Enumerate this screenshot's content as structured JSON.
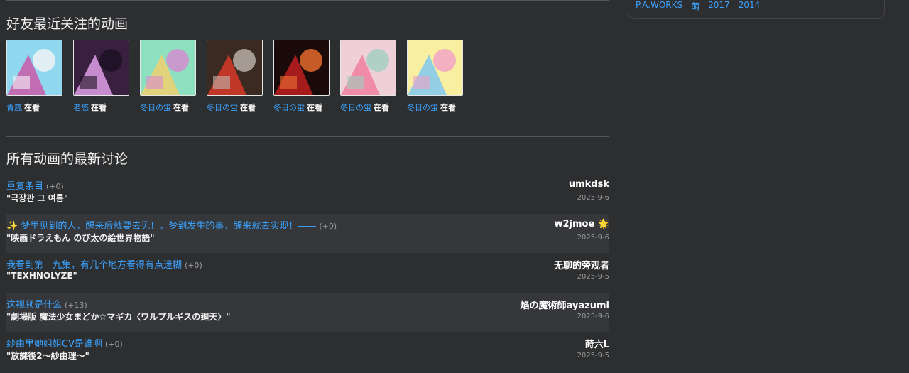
{
  "sidebar": {
    "tags": [
      "P.A.WORKS",
      "萌",
      "2017",
      "2014"
    ]
  },
  "friends_section": {
    "title": "好友最近关注的动画",
    "items": [
      {
        "user": "青嵐",
        "status": "在看",
        "colors": [
          "#8fd8f0",
          "#c95aa8",
          "#f5f5f5"
        ]
      },
      {
        "user": "老悠",
        "status": "在看",
        "colors": [
          "#3a2040",
          "#e0a0e8",
          "#1a1020"
        ]
      },
      {
        "user": "冬日の蛍",
        "status": "在看",
        "colors": [
          "#8de0c0",
          "#f0d070",
          "#d88ad0"
        ]
      },
      {
        "user": "冬日の蛍",
        "status": "在看",
        "colors": [
          "#3a2a22",
          "#d83828",
          "#c0b8b0"
        ]
      },
      {
        "user": "冬日の蛍",
        "status": "在看",
        "colors": [
          "#1a0a0a",
          "#c02020",
          "#f07030"
        ]
      },
      {
        "user": "冬日の蛍",
        "status": "在看",
        "colors": [
          "#f0d0d8",
          "#f080a0",
          "#a0d0c0"
        ]
      },
      {
        "user": "冬日の蛍",
        "status": "在看",
        "colors": [
          "#f8f0a0",
          "#80c8f0",
          "#f0a0c8"
        ]
      }
    ]
  },
  "topics_section": {
    "title": "所有动画的最新讨论",
    "topics": [
      {
        "title": "重复条目",
        "count": "(+0)",
        "subject": "\"극장판 그 여름\"",
        "user": "umkdsk",
        "date": "2025-9-6"
      },
      {
        "title": "✨ 梦里见到的人，醒来后就要去见！，梦到发生的事，醒来就去实现！——",
        "count": "(+0)",
        "subject": "\"映画ドラえもん のび太の絵世界物語\"",
        "user": "w2jmoe 🌟",
        "date": "2025-9-6"
      },
      {
        "title": "我看到第十九集，有几个地方看得有点迷糊",
        "count": "(+0)",
        "subject": "\"TEXHNOLYZE\"",
        "user": "无聊的旁观者",
        "date": "2025-9-5"
      },
      {
        "title": "这视频是什么",
        "count": "(+13)",
        "subject": "\"劇場版 魔法少女まどか☆マギカ〈ワルプルギスの廻天〉\"",
        "user": "焰の魔術師ayazumi",
        "date": "2025-9-6"
      },
      {
        "title": "纱由里她姐姐CV是谁啊",
        "count": "(+0)",
        "subject": "\"放課後2〜紗由理〜\"",
        "user": "莳六L",
        "date": "2025-9-5"
      }
    ]
  }
}
